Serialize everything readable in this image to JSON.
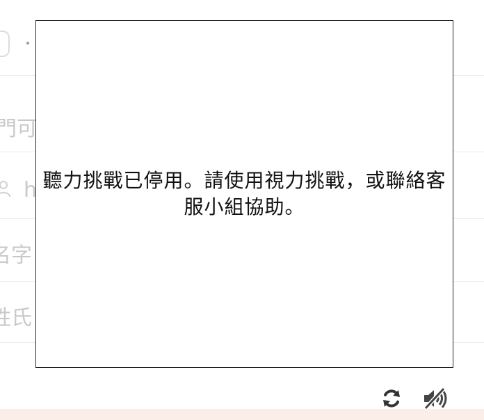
{
  "background_form": {
    "label_2": "門可",
    "label_3": "h",
    "label_4": "名字",
    "label_5": "姓氏"
  },
  "challenge": {
    "message": "聽力挑戰已停用。請使用視力挑戰，或聯絡客服小組協助。"
  },
  "controls": {
    "reload_icon": "reload-icon",
    "audio_disabled_icon": "audio-off-icon"
  },
  "colors": {
    "border": "#222222",
    "faded_text": "#c9c9c9",
    "bottom_bar": "#fbeee9",
    "icon": "#333333"
  }
}
